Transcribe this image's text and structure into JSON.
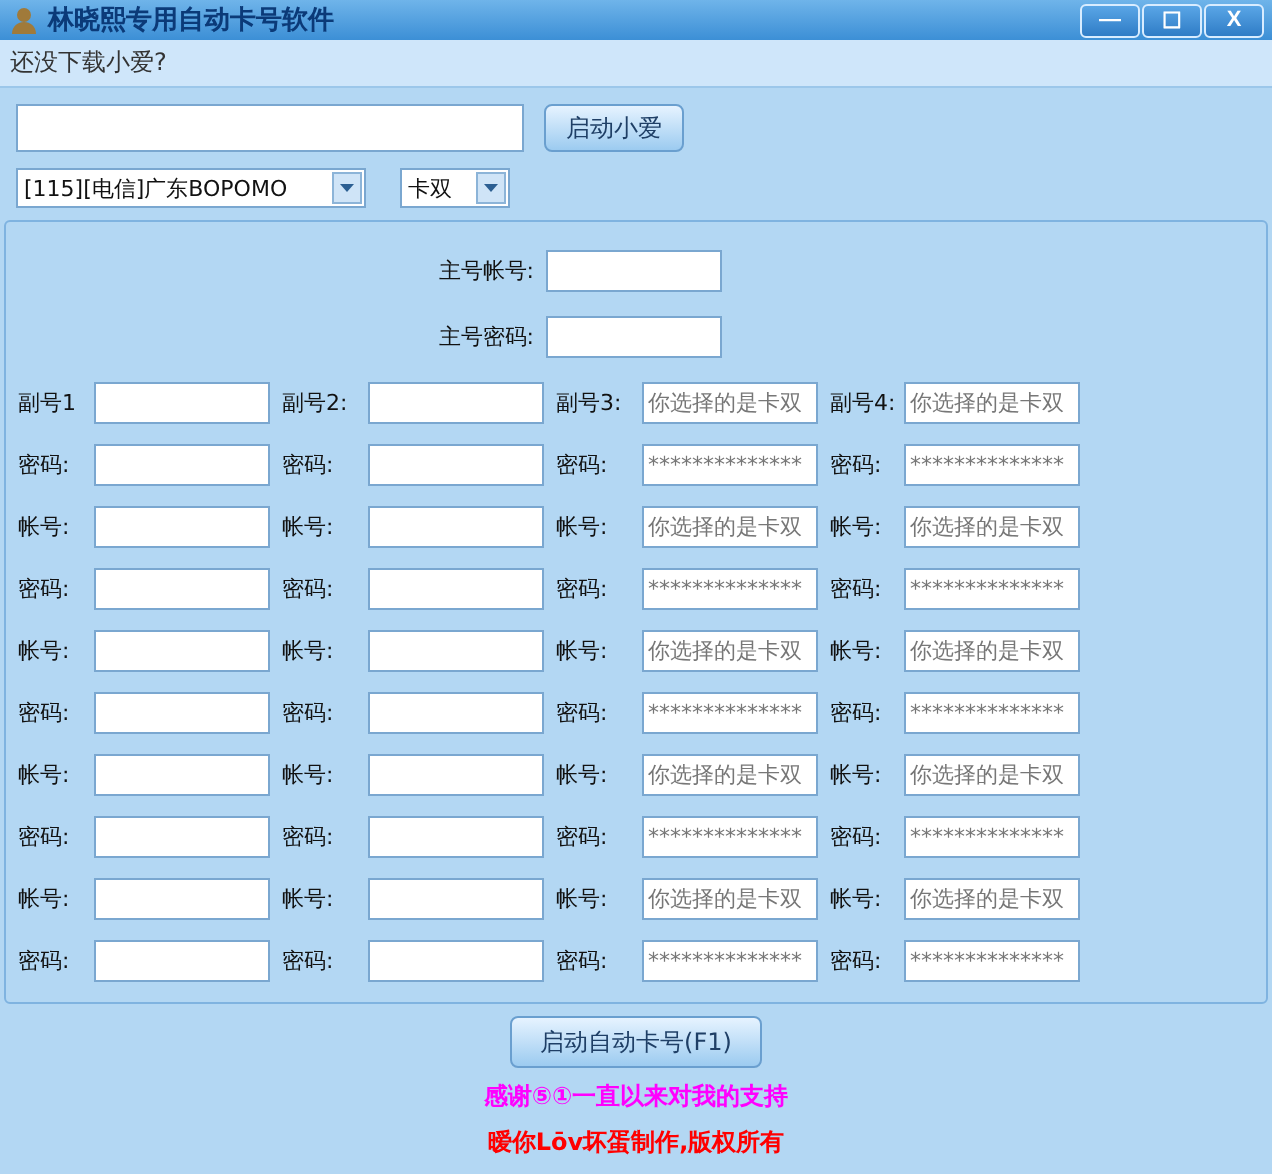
{
  "window": {
    "title": "林晓熙专用自动卡号软件",
    "buttons": [
      "—",
      "☐",
      "X"
    ]
  },
  "link": "还没下载小爱?",
  "top": {
    "start_button": "启动小爱",
    "server": "[115][电信]广东BOPOMO",
    "mode": "卡双"
  },
  "main": [
    {
      "label": "主号帐号:"
    },
    {
      "label": "主号密码:"
    }
  ],
  "grid": [
    [
      {
        "label": "副号1"
      },
      {
        "label": "副号2:"
      },
      {
        "label": "副号3:",
        "value": "你选择的是卡双"
      },
      {
        "label": "副号4:",
        "value": "你选择的是卡双"
      }
    ],
    [
      {
        "label": "密码:"
      },
      {
        "label": "密码:"
      },
      {
        "label": "密码:",
        "value": "**************"
      },
      {
        "label": "密码:",
        "value": "**************"
      }
    ],
    [
      {
        "label": "帐号:"
      },
      {
        "label": "帐号:"
      },
      {
        "label": "帐号:",
        "value": "你选择的是卡双"
      },
      {
        "label": "帐号:",
        "value": "你选择的是卡双"
      }
    ],
    [
      {
        "label": "密码:"
      },
      {
        "label": "密码:"
      },
      {
        "label": "密码:",
        "value": "**************"
      },
      {
        "label": "密码:",
        "value": "**************"
      }
    ],
    [
      {
        "label": "帐号:"
      },
      {
        "label": "帐号:"
      },
      {
        "label": "帐号:",
        "value": "你选择的是卡双"
      },
      {
        "label": "帐号:",
        "value": "你选择的是卡双"
      }
    ],
    [
      {
        "label": "密码:"
      },
      {
        "label": "密码:"
      },
      {
        "label": "密码:",
        "value": "**************"
      },
      {
        "label": "密码:",
        "value": "**************"
      }
    ],
    [
      {
        "label": "帐号:"
      },
      {
        "label": "帐号:"
      },
      {
        "label": "帐号:",
        "value": "你选择的是卡双"
      },
      {
        "label": "帐号:",
        "value": "你选择的是卡双"
      }
    ],
    [
      {
        "label": "密码:"
      },
      {
        "label": "密码:"
      },
      {
        "label": "密码:",
        "value": "**************"
      },
      {
        "label": "密码:",
        "value": "**************"
      }
    ],
    [
      {
        "label": "帐号:"
      },
      {
        "label": "帐号:"
      },
      {
        "label": "帐号:",
        "value": "你选择的是卡双"
      },
      {
        "label": "帐号:",
        "value": "你选择的是卡双"
      }
    ],
    [
      {
        "label": "密码:"
      },
      {
        "label": "密码:"
      },
      {
        "label": "密码:",
        "value": "**************"
      },
      {
        "label": "密码:",
        "value": "**************"
      }
    ]
  ],
  "run_button": "启动自动卡号(F1)",
  "credits": [
    {
      "text": "感谢⑤①一直以来对我的支持",
      "color": "#ff00ff"
    },
    {
      "text": "暧你Lōv坏蛋制作,版权所有",
      "color": "#ff0000"
    }
  ]
}
